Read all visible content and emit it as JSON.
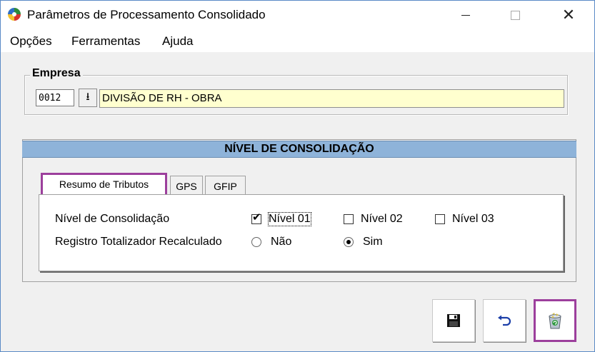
{
  "window": {
    "title": "Parâmetros de Processamento Consolidado",
    "close_glyph": "✕"
  },
  "menu": {
    "items": [
      {
        "label": "Opções"
      },
      {
        "label": "Ferramentas"
      },
      {
        "label": "Ajuda"
      }
    ]
  },
  "empresa": {
    "group_label": "Empresa",
    "code": "0012",
    "lookup_icon": "download-arrow-icon",
    "lookup_glyph": "⭳",
    "name": "DIVISÃO DE RH - OBRA"
  },
  "consolidacao": {
    "header": "NÍVEL DE CONSOLIDAÇÃO",
    "tabs": [
      {
        "label": "Resumo de Tributos",
        "active": true
      },
      {
        "label": "GPS"
      },
      {
        "label": "GFIP"
      }
    ],
    "nivel_label": "Nível de Consolidação",
    "nivel_options": [
      {
        "label": "Nível 01",
        "checked": true
      },
      {
        "label": "Nível 02",
        "checked": false
      },
      {
        "label": "Nível 03",
        "checked": false
      }
    ],
    "registro_label": "Registro Totalizador Recalculado",
    "registro_options": [
      {
        "label": "Não",
        "selected": false
      },
      {
        "label": "Sim",
        "selected": true
      }
    ]
  },
  "actions": {
    "save_icon": "floppy-disk-icon",
    "undo_icon": "undo-arrow-icon",
    "recycle_icon": "recycle-bin-icon"
  },
  "colors": {
    "highlight": "#9c3f9c",
    "panel_header": "#8eb3d9",
    "name_field_bg": "#ffffcf"
  }
}
